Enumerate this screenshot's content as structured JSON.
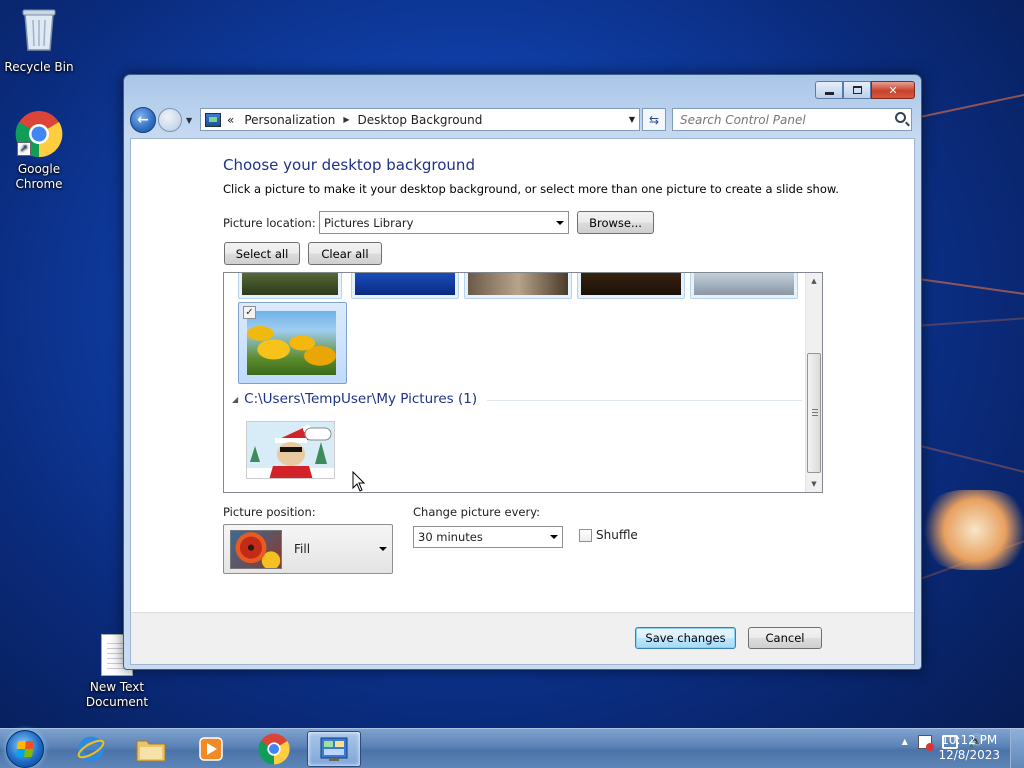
{
  "desktop": {
    "icons": [
      {
        "label": "Recycle Bin"
      },
      {
        "label": "Google Chrome"
      },
      {
        "label": "New Text Document"
      }
    ]
  },
  "window": {
    "breadcrumb": [
      "Personalization",
      "Desktop Background"
    ],
    "breadcrumb_prefix": "«",
    "search_placeholder": "Search Control Panel",
    "caption": {
      "minimize": "▭",
      "maximize": "❐",
      "close": "✕"
    }
  },
  "content": {
    "title": "Choose your desktop background",
    "subtitle": "Click a picture to make it your desktop background, or select more than one picture to create a slide show.",
    "picture_location_label": "Picture location:",
    "picture_location_value": "Pictures Library",
    "browse_label": "Browse...",
    "select_all_label": "Select all",
    "clear_all_label": "Clear all",
    "group_header": "C:\\Users\\TempUser\\My Pictures (1)",
    "selected_checkbox": "✓",
    "picture_position_label": "Picture position:",
    "picture_position_value": "Fill",
    "change_every_label": "Change picture every:",
    "change_every_value": "30 minutes",
    "shuffle_label": "Shuffle",
    "save_label": "Save changes",
    "cancel_label": "Cancel"
  },
  "taskbar": {
    "time": "10:12 PM",
    "date": "12/8/2023",
    "tray_arrow": "▲"
  },
  "colors": {
    "title_blue": "#1e3287",
    "desktop_blue": "#0f3fa8"
  }
}
